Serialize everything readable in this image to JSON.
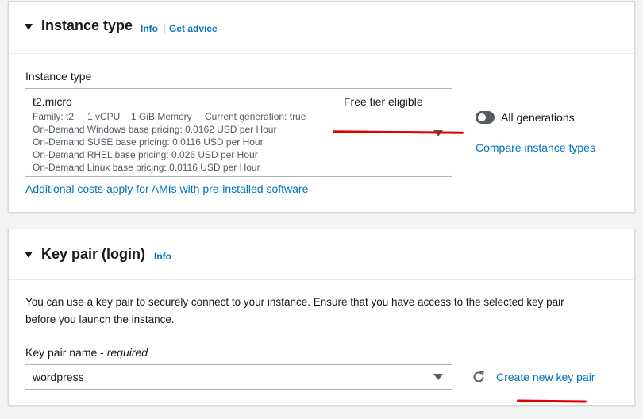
{
  "instance_panel": {
    "title": "Instance type",
    "info": "Info",
    "get_advice": "Get advice",
    "separator": "|",
    "field_label": "Instance type",
    "selected": {
      "name": "t2.micro",
      "free_tier": "Free tier eligible",
      "family": "Family: t2",
      "vcpu": "1 vCPU",
      "memory": "1 GiB Memory",
      "generation": "Current generation: true",
      "pricing_windows": "On-Demand Windows base pricing: 0.0162 USD per Hour",
      "pricing_suse": "On-Demand SUSE base pricing: 0.0116 USD per Hour",
      "pricing_rhel": "On-Demand RHEL base pricing: 0.026 USD per Hour",
      "pricing_linux": "On-Demand Linux base pricing: 0.0116 USD per Hour"
    },
    "all_generations_label": "All generations",
    "all_generations_on": false,
    "compare_link": "Compare instance types",
    "additional_costs_link": "Additional costs apply for AMIs with pre-installed software"
  },
  "keypair_panel": {
    "title": "Key pair (login)",
    "info": "Info",
    "description_line1": "You can use a key pair to securely connect to your instance. Ensure that you have access to the selected key pair",
    "description_line2": "before you launch the instance.",
    "field_label": "Key pair name - ",
    "field_required": "required",
    "selected_value": "wordpress",
    "create_link": "Create new key pair"
  },
  "colors": {
    "link": "#0073bb",
    "annotation": "#e00000",
    "toggle_off": "#545b64"
  },
  "icons": [
    "caret-down-icon",
    "dropdown-arrow-icon",
    "refresh-icon"
  ]
}
